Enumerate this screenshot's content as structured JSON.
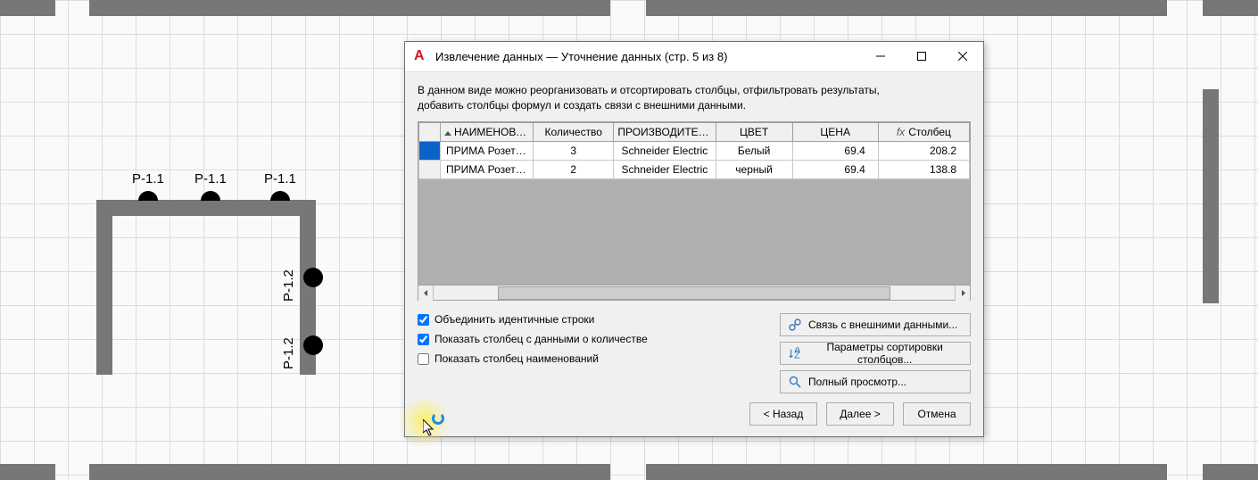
{
  "dialog": {
    "title": "Извлечение данных — Уточнение данных (стр. 5 из 8)",
    "description_l1": "В данном виде можно реорганизовать и отсортировать столбцы, отфильтровать результаты,",
    "description_l2": "добавить столбцы формул и создать связи с внешними данными."
  },
  "columns": {
    "c0": "НАИМЕНОВАНИЕ",
    "c1": "Количество",
    "c2": "ПРОИЗВОДИТЕЛЬ",
    "c3": "ЦВЕТ",
    "c4": "ЦЕНА",
    "c5": "Столбец"
  },
  "rows": [
    {
      "name": "ПРИМА Розетк...",
      "qty": "3",
      "mfr": "Schneider Electric",
      "color": "Белый",
      "price": "69.4",
      "calc": "208.2"
    },
    {
      "name": "ПРИМА Розетк...",
      "qty": "2",
      "mfr": "Schneider Electric",
      "color": "черный",
      "price": "69.4",
      "calc": "138.8"
    }
  ],
  "checks": {
    "merge": "Объединить идентичные строки",
    "qty": "Показать столбец с данными о количестве",
    "names": "Показать столбец наименований"
  },
  "sidebtn": {
    "link": "Связь с внешними данными...",
    "sort": "Параметры сортировки столбцов...",
    "preview": "Полный просмотр..."
  },
  "nav": {
    "back": "< Назад",
    "next": "Далее >",
    "cancel": "Отмена"
  },
  "cad_labels": {
    "p11": "P-1.1",
    "p12": "P-1.2"
  }
}
